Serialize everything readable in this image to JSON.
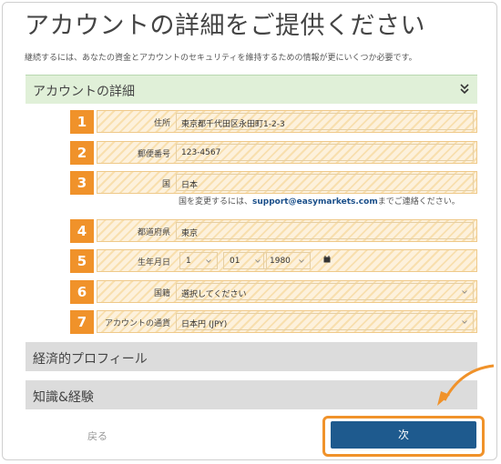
{
  "page": {
    "title": "アカウントの詳細をご提供ください",
    "subtitle": "継続するには、あなたの資金とアカウントのセキュリティを維持するための情報が更にいくつか必要です。"
  },
  "sections": {
    "account_details": "アカウントの詳細",
    "economic_profile": "経済的プロフィール",
    "knowledge": "知識&経験"
  },
  "fields": [
    {
      "num": "1",
      "label": "住所",
      "value": "東京都千代田区永田町1-2-3"
    },
    {
      "num": "2",
      "label": "郵便番号",
      "value": "123-4567"
    },
    {
      "num": "3",
      "label": "国",
      "value": "日本"
    },
    {
      "num": "4",
      "label": "都道府県",
      "value": "東京"
    },
    {
      "num": "5",
      "label": "生年月日",
      "day": "1",
      "month": "01",
      "year": "1980"
    },
    {
      "num": "6",
      "label": "国籍",
      "value": "選択してください"
    },
    {
      "num": "7",
      "label": "アカウントの通貨",
      "value": "日本円 (JPY)"
    }
  ],
  "country_note": {
    "prefix": "国を変更するには、",
    "email": "support@easymarkets.com",
    "suffix": "までご連絡ください。"
  },
  "buttons": {
    "back": "戻る",
    "next": "次"
  },
  "colors": {
    "badge": "#f0922a",
    "next": "#1e5a8e",
    "section_open": "#e0f0d8",
    "section_closed": "#dcdcdc"
  }
}
